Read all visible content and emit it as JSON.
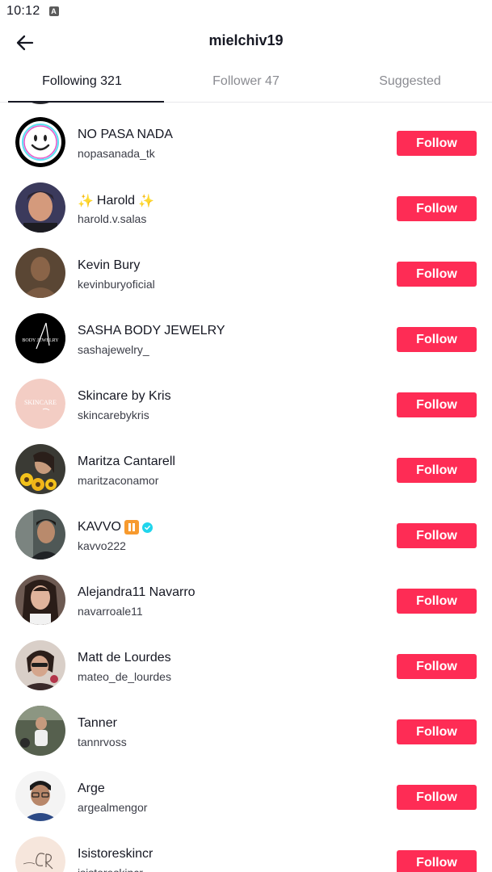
{
  "status_bar": {
    "time": "10:12",
    "notification_icon": "A"
  },
  "header": {
    "back_icon": "arrow-left-icon",
    "title": "mielchiv19"
  },
  "tabs": [
    {
      "label": "Following 321",
      "active": true
    },
    {
      "label": "Follower 47",
      "active": false
    },
    {
      "label": "Suggested",
      "active": false
    }
  ],
  "follow_button_color": "#fe2c55",
  "accounts": [
    {
      "name": "NO PASA NADA",
      "handle": "nopasanada_tk",
      "button": "Follow"
    },
    {
      "name": "Harold",
      "name_decor": "✨",
      "handle": "harold.v.salas",
      "button": "Follow"
    },
    {
      "name": "Kevin Bury",
      "handle": "kevinburyoficial",
      "button": "Follow"
    },
    {
      "name": "SASHA BODY JEWELRY",
      "handle": "sashajewelry_",
      "button": "Follow",
      "avatar_text": "BODY JEWELRY"
    },
    {
      "name": "Skincare by Kris",
      "handle": "skincarebykris",
      "button": "Follow",
      "avatar_text": "SKINCARE"
    },
    {
      "name": "Maritza Cantarell",
      "handle": "maritzaconamor",
      "button": "Follow"
    },
    {
      "name": "KAVVO",
      "handle": "kavvo222",
      "button": "Follow",
      "verified": true
    },
    {
      "name": "Alejandra11 Navarro",
      "handle": "navarroale11",
      "button": "Follow"
    },
    {
      "name": "Matt de Lourdes",
      "handle": "mateo_de_lourdes",
      "button": "Follow"
    },
    {
      "name": "Tanner",
      "handle": "tannrvoss",
      "button": "Follow"
    },
    {
      "name": "Arge",
      "handle": "argealmengor",
      "button": "Follow"
    },
    {
      "name": "Isistoreskincr",
      "handle": "isistoreskincr",
      "button": "Follow"
    }
  ]
}
